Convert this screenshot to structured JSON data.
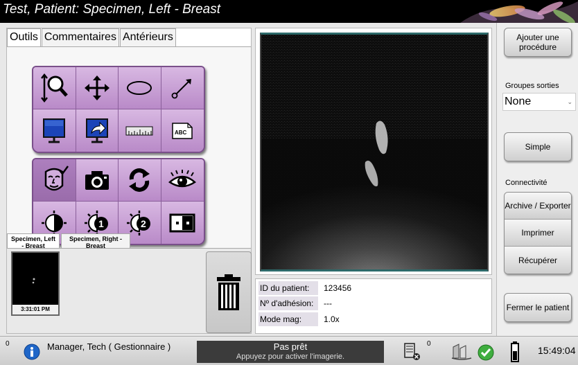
{
  "window": {
    "title": "Test, Patient:  Specimen, Left - Breast"
  },
  "left_tabs": [
    {
      "label": "Outils",
      "active": true
    },
    {
      "label": "Commentaires",
      "active": false
    },
    {
      "label": "Antérieurs",
      "active": false
    }
  ],
  "tool_icons": {
    "row1": [
      "zoom-icon",
      "pan-icon",
      "ellipse-icon",
      "arrow-icon"
    ],
    "row2": [
      "invert-display-icon",
      "send-image-icon",
      "ruler-icon",
      "text-annotation-icon"
    ],
    "row3": [
      "patient-face-icon",
      "camera-icon",
      "refresh-icon",
      "eye-icon"
    ],
    "row4": [
      "window-level-icon",
      "window-level-1-icon",
      "window-level-2-icon",
      "pixel-display-icon"
    ]
  },
  "tool_text": {
    "text_annotation": "ABC",
    "preset1": "1",
    "preset2": "2"
  },
  "thumbnail_tabs": [
    {
      "label": "Specimen, Left - Breast",
      "active": true
    },
    {
      "label": "Specimen, Right - Breast",
      "active": false
    }
  ],
  "thumbnail": {
    "time": "3:31:01 PM"
  },
  "patient_info": {
    "rows": [
      {
        "label": "ID du patient:",
        "value": "123456"
      },
      {
        "label": "Nº d'adhésion:",
        "value": "---"
      },
      {
        "label": "Mode mag:",
        "value": "1.0x"
      }
    ]
  },
  "right_panel": {
    "add_procedure": "Ajouter une procédure",
    "output_groups_label": "Groupes sorties",
    "output_groups_value": "None",
    "simple": "Simple",
    "connectivity_label": "Connectivité",
    "archive_export": "Archive / Exporter",
    "print": "Imprimer",
    "retrieve": "Récupérer",
    "close_patient": "Fermer le patient"
  },
  "status_bar": {
    "left_count": "0",
    "user": "Manager, Tech ( Gestionnaire )",
    "state_title": "Pas prêt",
    "state_subtitle": "Appuyez pour activer l'imagerie.",
    "queue_count": "0",
    "clock": "15:49:04"
  },
  "colors": {
    "tool_panel": "#c39bd0",
    "tool_border": "#7a4f8a",
    "viewer_edge": "#2d6a6a",
    "status_center": "#3b3b3b"
  }
}
